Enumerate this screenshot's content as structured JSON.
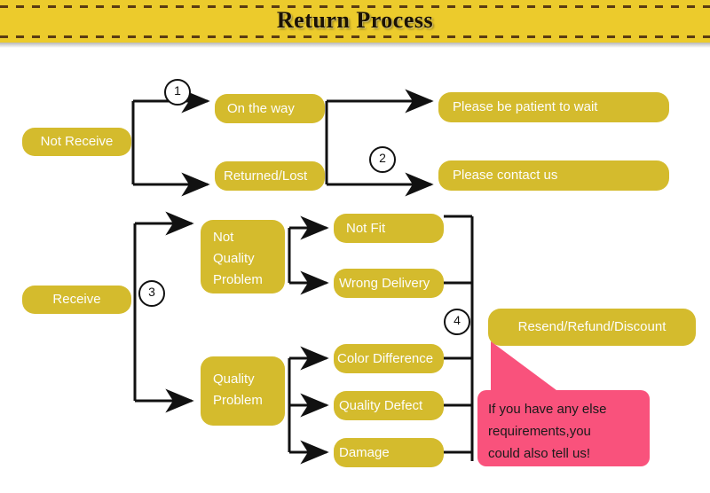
{
  "header": {
    "title": "Return Process",
    "banner_color": "#eccb2c",
    "rule_color": "#5a3b12"
  },
  "theme": {
    "node_color": "#d4bb2d",
    "node_text_color": "#fdfdfb",
    "connector_color": "#111111",
    "callout_color": "#f9527c",
    "callout_text_color": "#1a1a1a",
    "page_background": "#ffffff"
  },
  "diagram": {
    "nodes": [
      {
        "id": "not-receive",
        "label": "Not Receive"
      },
      {
        "id": "on-the-way",
        "label": "On the way"
      },
      {
        "id": "returned-lost",
        "label": "Returned/Lost"
      },
      {
        "id": "please-be-patient",
        "label": "Please be patient to wait"
      },
      {
        "id": "please-contact-us",
        "label": "Please contact us"
      },
      {
        "id": "receive",
        "label": "Receive"
      },
      {
        "id": "not-quality-problem",
        "label": "Not Quality Problem",
        "lines": [
          "Not",
          "Quality",
          "Problem"
        ]
      },
      {
        "id": "quality-problem",
        "label": "Quality Problem",
        "lines": [
          "Quality",
          "Problem"
        ]
      },
      {
        "id": "not-fit",
        "label": "Not Fit"
      },
      {
        "id": "wrong-delivery",
        "label": "Wrong Delivery"
      },
      {
        "id": "color-difference",
        "label": "Color Difference"
      },
      {
        "id": "quality-defect",
        "label": "Quality Defect"
      },
      {
        "id": "damage",
        "label": "Damage"
      },
      {
        "id": "resend-refund-discount",
        "label": "Resend/Refund/Discount"
      }
    ],
    "step_markers": [
      {
        "id": "step-1",
        "label": "1"
      },
      {
        "id": "step-2",
        "label": "2"
      },
      {
        "id": "step-3",
        "label": "3"
      },
      {
        "id": "step-4",
        "label": "4"
      }
    ]
  },
  "callout": {
    "lines": [
      "If you have any else",
      "requirements,you",
      "could also tell us!"
    ]
  }
}
